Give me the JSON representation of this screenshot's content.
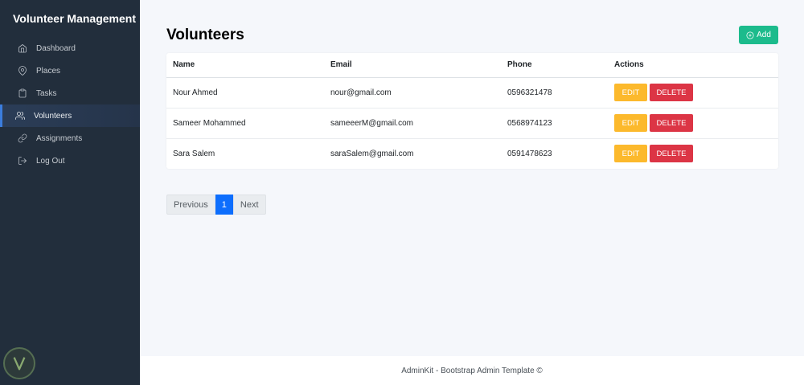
{
  "sidebar": {
    "brand": "Volunteer Management",
    "items": [
      {
        "label": "Dashboard",
        "icon": "home-icon"
      },
      {
        "label": "Places",
        "icon": "map-pin-icon"
      },
      {
        "label": "Tasks",
        "icon": "clipboard-icon"
      },
      {
        "label": "Volunteers",
        "icon": "users-icon",
        "active": true
      },
      {
        "label": "Assignments",
        "icon": "link-icon"
      },
      {
        "label": "Log Out",
        "icon": "log-out-icon"
      }
    ]
  },
  "main": {
    "title": "Volunteers",
    "add_label": "Add",
    "table": {
      "headers": [
        "Name",
        "Email",
        "Phone",
        "Actions"
      ],
      "rows": [
        {
          "name": "Nour Ahmed",
          "email": "nour@gmail.com",
          "phone": "0596321478"
        },
        {
          "name": "Sameer Mohammed",
          "email": "sameeerM@gmail.com",
          "phone": "0568974123"
        },
        {
          "name": "Sara Salem",
          "email": "saraSalem@gmail.com",
          "phone": "0591478623"
        }
      ],
      "edit_label": "EDIT",
      "delete_label": "DELETE"
    },
    "pagination": {
      "previous": "Previous",
      "current": "1",
      "next": "Next"
    }
  },
  "footer": {
    "text": "AdminKit - Bootstrap Admin Template ©"
  },
  "colors": {
    "sidebar_bg": "#222e3c",
    "success": "#1cbb8c",
    "warning": "#fcb92c",
    "danger": "#dc3545",
    "primary": "#0d6efd"
  }
}
